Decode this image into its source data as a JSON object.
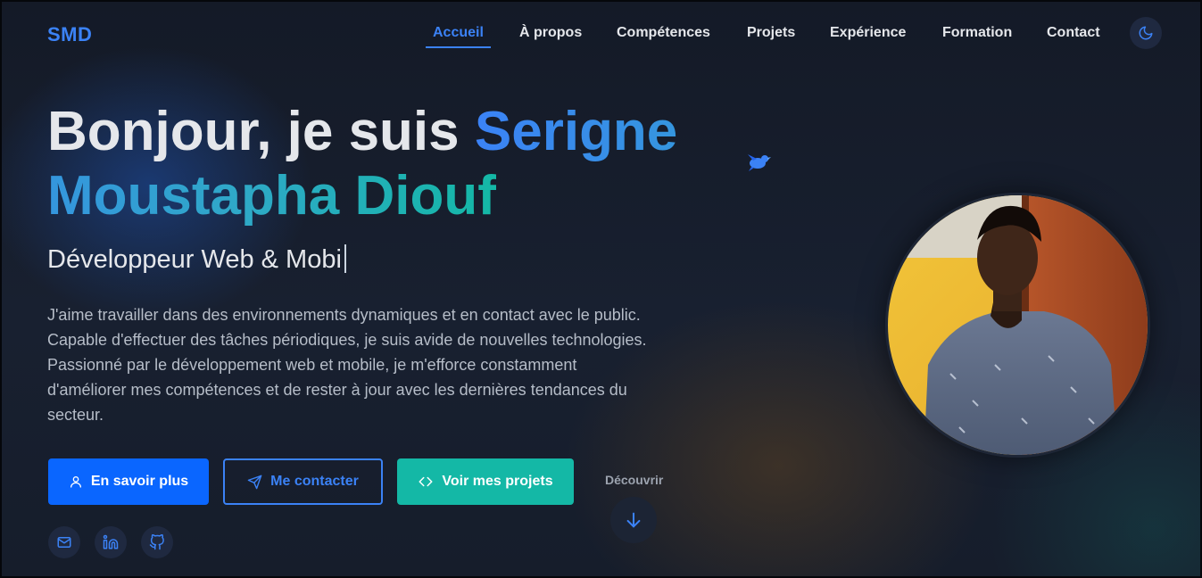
{
  "brand": "SMD",
  "nav": {
    "items": [
      {
        "label": "Accueil",
        "active": true
      },
      {
        "label": "À propos",
        "active": false
      },
      {
        "label": "Compétences",
        "active": false
      },
      {
        "label": "Projets",
        "active": false
      },
      {
        "label": "Expérience",
        "active": false
      },
      {
        "label": "Formation",
        "active": false
      },
      {
        "label": "Contact",
        "active": false
      }
    ],
    "theme_toggle_icon": "moon-icon"
  },
  "hero": {
    "greeting": "Bonjour, je suis ",
    "name": "Serigne Moustapha Diouf",
    "role_typed": "Développeur Web & Mobi",
    "description": "J'aime travailler dans des environnements dynamiques et en contact avec le public. Capable d'effectuer des tâches périodiques, je suis avide de nouvelles technologies. Passionné par le développement web et mobile, je m'efforce constamment d'améliorer mes compétences et de rester à jour avec les dernières tendances du secteur."
  },
  "buttons": {
    "learn_more": {
      "label": "En savoir plus",
      "icon": "user-icon"
    },
    "contact": {
      "label": "Me contacter",
      "icon": "send-icon"
    },
    "projects": {
      "label": "Voir mes projets",
      "icon": "code-icon"
    }
  },
  "discover": {
    "label": "Découvrir",
    "icon": "arrow-down-icon"
  },
  "social": [
    {
      "icon": "mail-icon"
    },
    {
      "icon": "linkedin-icon"
    },
    {
      "icon": "github-icon"
    }
  ],
  "colors": {
    "accent": "#3b82f6",
    "primary_button": "#0a66ff",
    "teal": "#14b8a6",
    "background": "#151b29"
  }
}
